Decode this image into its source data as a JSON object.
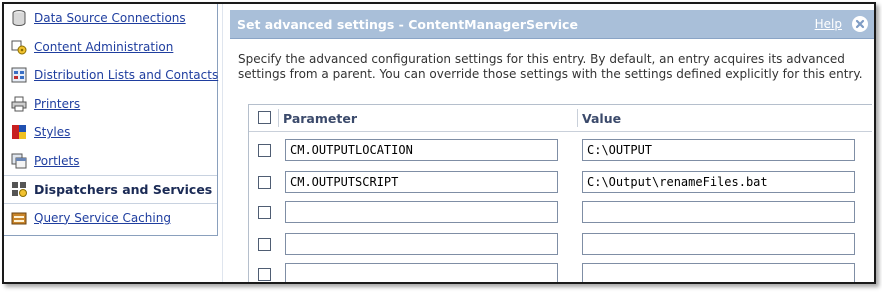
{
  "nav": {
    "items": [
      {
        "label": "Data Source Connections",
        "icon": "database-icon"
      },
      {
        "label": "Content Administration",
        "icon": "content-admin-icon"
      },
      {
        "label": "Distribution Lists and Contacts",
        "icon": "distribution-list-icon"
      },
      {
        "label": "Printers",
        "icon": "printer-icon"
      },
      {
        "label": "Styles",
        "icon": "styles-icon"
      },
      {
        "label": "Portlets",
        "icon": "portlets-icon"
      },
      {
        "label": "Dispatchers and Services",
        "icon": "dispatchers-icon"
      },
      {
        "label": "Query Service Caching",
        "icon": "query-cache-icon"
      }
    ],
    "active_item": "Dispatchers and Services"
  },
  "dialog": {
    "title": "Set advanced settings - ContentManagerService",
    "help_label": "Help",
    "description": "Specify the advanced configuration settings for this entry. By default, an entry acquires its advanced settings from a parent. You can override those settings with the settings defined explicitly for this entry."
  },
  "table": {
    "columns": [
      "Parameter",
      "Value"
    ],
    "rows": [
      {
        "parameter": "CM.OUTPUTLOCATION",
        "value": "C:\\OUTPUT"
      },
      {
        "parameter": "CM.OUTPUTSCRIPT",
        "value": "C:\\Output\\renameFiles.bat"
      },
      {
        "parameter": "",
        "value": ""
      },
      {
        "parameter": "",
        "value": ""
      },
      {
        "parameter": "",
        "value": ""
      }
    ]
  },
  "colors": {
    "title_bar": "#a9bfd9",
    "link": "#1f3e9f"
  }
}
